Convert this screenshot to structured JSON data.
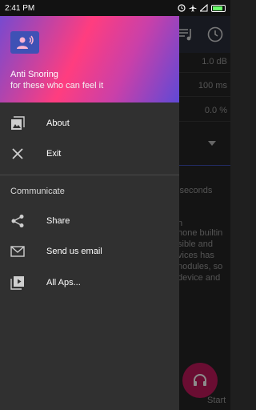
{
  "status_bar": {
    "time": "2:41 PM"
  },
  "background": {
    "rows": [
      "1.0 dB",
      "100 ms",
      "0.0 %"
    ],
    "text_lines": [
      "iseconds",
      "n",
      "hone builtin",
      "sible and",
      "vices has",
      "nodules, so",
      "device and"
    ],
    "fab_label": "Start"
  },
  "drawer": {
    "header": {
      "app_name": "Anti Snoring",
      "tagline": "for these who can feel it"
    },
    "items": [
      {
        "label": "About",
        "icon": "image-icon"
      },
      {
        "label": "Exit",
        "icon": "close-icon"
      }
    ],
    "section_title": "Communicate",
    "communicate_items": [
      {
        "label": "Share",
        "icon": "share-icon"
      },
      {
        "label": "Send us email",
        "icon": "email-icon"
      },
      {
        "label": "All Aps...",
        "icon": "play-library-icon"
      }
    ]
  },
  "colors": {
    "accent": "#c2185b",
    "drawer_bg": "#303030",
    "header_icon_bg": "#3f51b5"
  }
}
